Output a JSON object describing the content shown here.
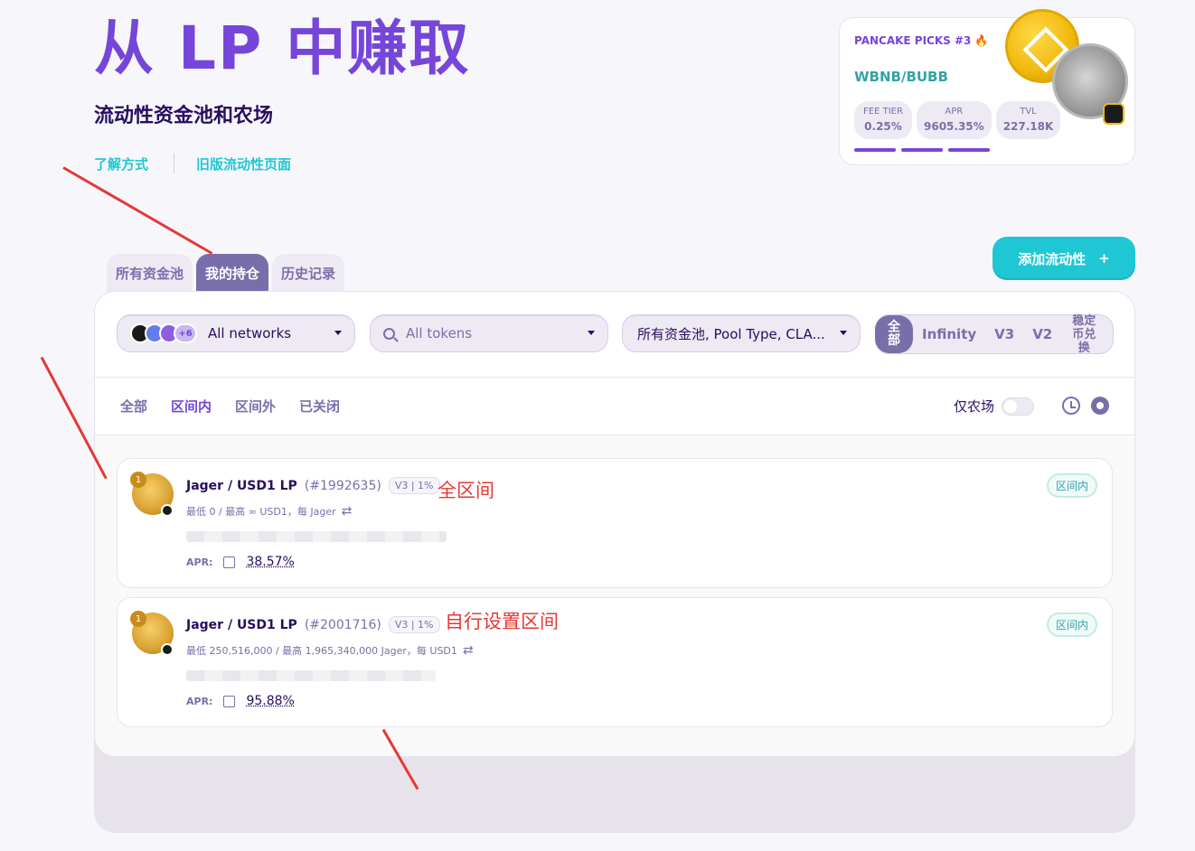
{
  "hero": {
    "title": "从 LP 中赚取",
    "subtitle": "流动性资金池和农场",
    "link_learn": "了解方式",
    "link_legacy": "旧版流动性页面"
  },
  "picks": {
    "heading": "PANCAKE PICKS #3",
    "pair": "WBNB/BUBB",
    "stats": [
      {
        "label": "FEE TIER",
        "value": "0.25%"
      },
      {
        "label": "APR",
        "value": "9605.35%"
      },
      {
        "label": "TVL",
        "value": "227.18K"
      }
    ]
  },
  "add_button": {
    "label": "添加流动性",
    "icon": "+"
  },
  "tabs": [
    {
      "label": "所有资金池"
    },
    {
      "label": "我的持仓"
    },
    {
      "label": "历史记录"
    }
  ],
  "toolbar": {
    "networks": {
      "label": "All networks",
      "more_count": "+6"
    },
    "tokens": {
      "placeholder": "All tokens"
    },
    "pool_types": {
      "label": "所有资金池, Pool Type, CLA..."
    },
    "versions": {
      "all": "全部",
      "infinity": "Infinity",
      "v3": "V3",
      "v2": "V2",
      "stable": "稳定币兑换"
    }
  },
  "filters": {
    "items": [
      "全部",
      "区间内",
      "区间外",
      "已关闭"
    ],
    "farm_only_label": "仅农场"
  },
  "positions": [
    {
      "pair": "Jager / USD1 LP",
      "id": "(#1992635)",
      "tag": "V3 | 1%",
      "range": "最低 0 / 最高 ∞ USD1，每 Jager",
      "apr_label": "APR:",
      "apr": "38.57%",
      "status": "区间内",
      "annotation": "全区间"
    },
    {
      "pair": "Jager / USD1 LP",
      "id": "(#2001716)",
      "tag": "V3 | 1%",
      "range": "最低 250,516,000 / 最高 1,965,340,000 Jager，每 USD1",
      "apr_label": "APR:",
      "apr": "95.88%",
      "status": "区间内",
      "annotation": "自行设置区间"
    }
  ],
  "colors": {
    "primary": "#7645d9",
    "secondary": "#1fc7d4",
    "text": "#280d5f",
    "subtle": "#7a6eaa",
    "annotation": "#e53935"
  }
}
